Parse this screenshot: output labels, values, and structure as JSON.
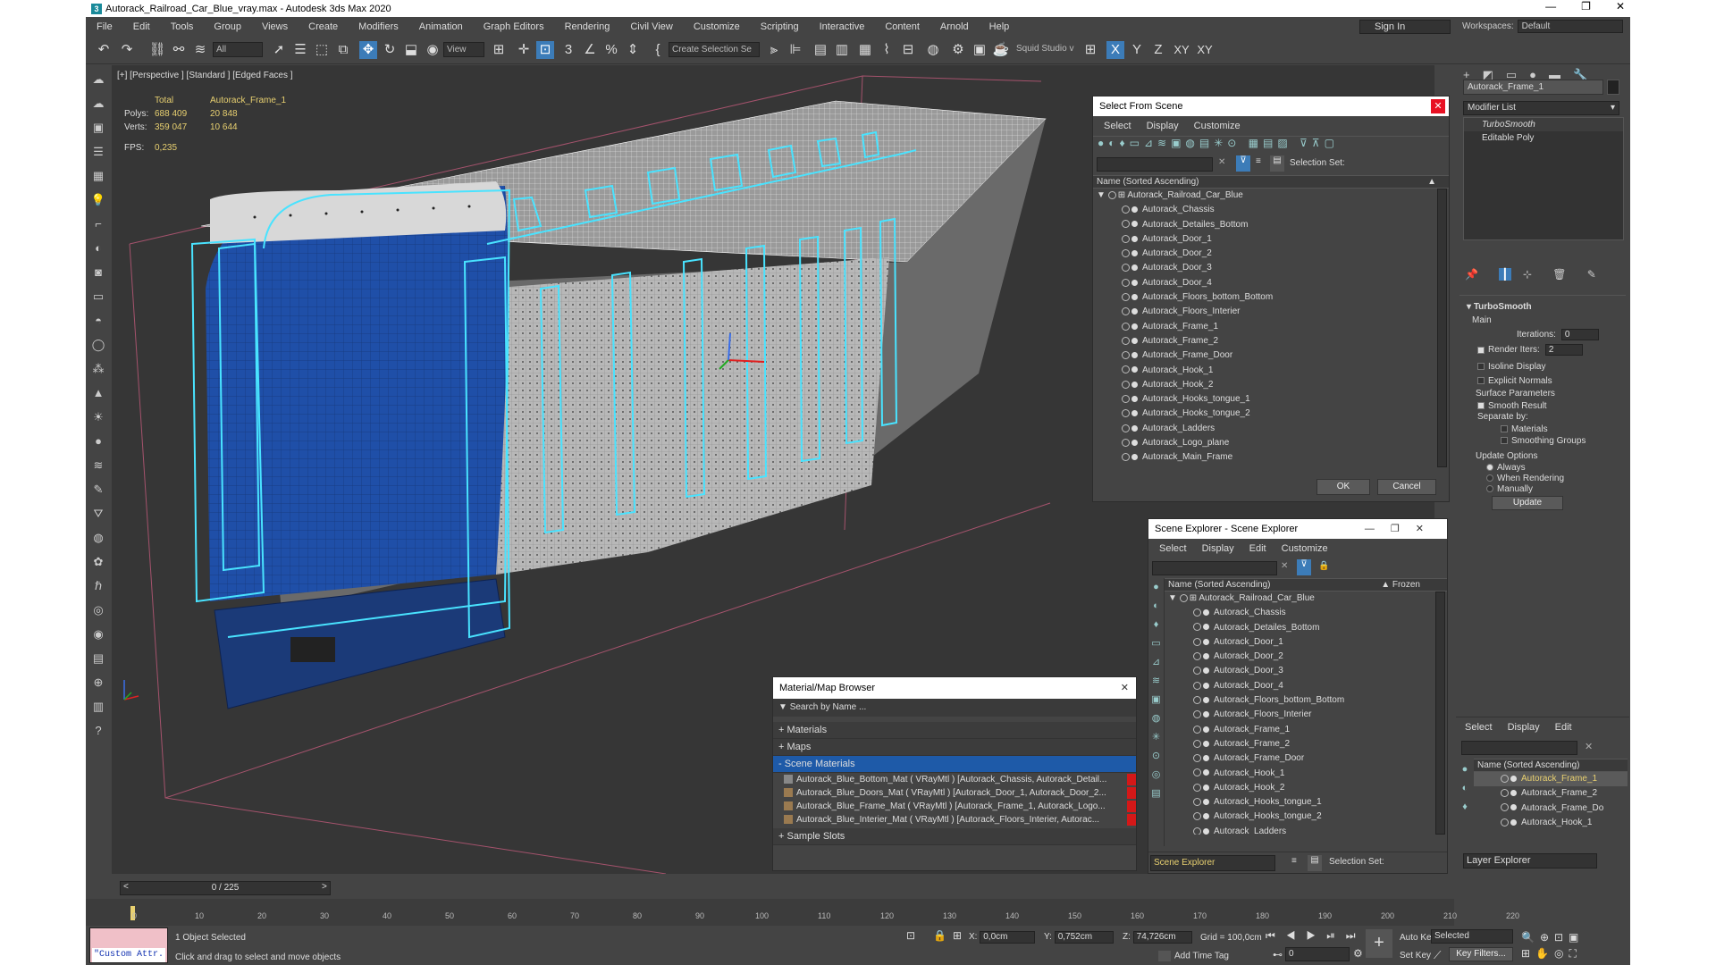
{
  "title": "Autorack_Railroad_Car_Blue_vray.max - Autodesk 3ds Max 2020",
  "menu": [
    "File",
    "Edit",
    "Tools",
    "Group",
    "Views",
    "Create",
    "Modifiers",
    "Animation",
    "Graph Editors",
    "Rendering",
    "Civil View",
    "Customize",
    "Scripting",
    "Interactive",
    "Content",
    "Arnold",
    "Help"
  ],
  "account": {
    "signin": "Sign In",
    "workspaces_label": "Workspaces:",
    "workspace": "Default"
  },
  "toolbar": {
    "filter": "All",
    "view": "View",
    "selection_set": "Create Selection Se",
    "squid": "Squid Studio v",
    "axes": [
      "X",
      "Y",
      "Z",
      "XY",
      "XY"
    ]
  },
  "viewport": {
    "label": "[+] [Perspective ] [Standard ] [Edged Faces ]",
    "stats": {
      "total_label": "Total",
      "object": "Autorack_Frame_1",
      "polys_label": "Polys:",
      "polys_total": "688 409",
      "polys_obj": "20 848",
      "verts_label": "Verts:",
      "verts_total": "359 047",
      "verts_obj": "10 644",
      "fps_label": "FPS:",
      "fps": "0,235"
    }
  },
  "select_from_scene": {
    "title": "Select From Scene",
    "menu": [
      "Select",
      "Display",
      "Customize"
    ],
    "selection_set_label": "Selection Set:",
    "header": "Name (Sorted Ascending)",
    "root": "Autorack_Railroad_Car_Blue",
    "items": [
      "Autorack_Chassis",
      "Autorack_Detailes_Bottom",
      "Autorack_Door_1",
      "Autorack_Door_2",
      "Autorack_Door_3",
      "Autorack_Door_4",
      "Autorack_Floors_bottom_Bottom",
      "Autorack_Floors_Interier",
      "Autorack_Frame_1",
      "Autorack_Frame_2",
      "Autorack_Frame_Door",
      "Autorack_Hook_1",
      "Autorack_Hook_2",
      "Autorack_Hooks_tongue_1",
      "Autorack_Hooks_tongue_2",
      "Autorack_Ladders",
      "Autorack_Logo_plane",
      "Autorack_Main_Frame"
    ],
    "ok": "OK",
    "cancel": "Cancel"
  },
  "scene_explorer": {
    "title": "Scene Explorer - Scene Explorer",
    "menu": [
      "Select",
      "Display",
      "Edit",
      "Customize"
    ],
    "header": "Name (Sorted Ascending)",
    "frozen": "▲ Frozen",
    "root": "Autorack_Railroad_Car_Blue",
    "items": [
      "Autorack_Chassis",
      "Autorack_Detailes_Bottom",
      "Autorack_Door_1",
      "Autorack_Door_2",
      "Autorack_Door_3",
      "Autorack_Door_4",
      "Autorack_Floors_bottom_Bottom",
      "Autorack_Floors_Interier",
      "Autorack_Frame_1",
      "Autorack_Frame_2",
      "Autorack_Frame_Door",
      "Autorack_Hook_1",
      "Autorack_Hook_2",
      "Autorack_Hooks_tongue_1",
      "Autorack_Hooks_tongue_2",
      "Autorack_Ladders"
    ],
    "footer": "Scene Explorer",
    "selection_set_label": "Selection Set:"
  },
  "material_browser": {
    "title": "Material/Map Browser",
    "search": "Search by Name ...",
    "groups": [
      "+ Materials",
      "+ Maps",
      "- Scene Materials",
      "+ Sample Slots"
    ],
    "materials": [
      "Autorack_Blue_Bottom_Mat ( VRayMtl ) [Autorack_Chassis, Autorack_Detail...",
      "Autorack_Blue_Doors_Mat ( VRayMtl ) [Autorack_Door_1, Autorack_Door_2...",
      "Autorack_Blue_Frame_Mat ( VRayMtl ) [Autorack_Frame_1, Autorack_Logo...",
      "Autorack_Blue_Interier_Mat ( VRayMtl ) [Autorack_Floors_Interier, Autorac..."
    ]
  },
  "command_panel": {
    "object_name": "Autorack_Frame_1",
    "modifier_list": "Modifier List",
    "stack": [
      "TurboSmooth",
      "Editable Poly"
    ],
    "turbosmooth": {
      "title": "TurboSmooth",
      "main": "Main",
      "iterations_label": "Iterations:",
      "iterations": "0",
      "render_iters_label": "Render Iters:",
      "render_iters": "2",
      "isoline": "Isoline Display",
      "explicit": "Explicit Normals",
      "surface": "Surface Parameters",
      "smooth": "Smooth Result",
      "separate": "Separate by:",
      "materials": "Materials",
      "smoothing": "Smoothing Groups",
      "update_options": "Update Options",
      "always": "Always",
      "when_rendering": "When Rendering",
      "manually": "Manually",
      "update": "Update"
    }
  },
  "layer_explorer": {
    "menu": [
      "Select",
      "Display",
      "Edit"
    ],
    "header": "Name (Sorted Ascending)",
    "items": [
      "Autorack_Frame_1",
      "Autorack_Frame_2",
      "Autorack_Frame_Do",
      "Autorack_Hook_1"
    ],
    "footer": "Layer Explorer"
  },
  "timeline": {
    "frame": "0 / 225",
    "ticks": [
      "0",
      "10",
      "20",
      "30",
      "40",
      "50",
      "60",
      "70",
      "80",
      "90",
      "100",
      "110",
      "120",
      "130",
      "140",
      "150",
      "160",
      "170",
      "180",
      "190",
      "200",
      "210",
      "220"
    ]
  },
  "status": {
    "maxscript": "\"Custom Attr.",
    "selected": "1 Object Selected",
    "prompt": "Click and drag to select and move objects",
    "x_label": "X:",
    "x": "0,0cm",
    "y_label": "Y:",
    "y": "0,752cm",
    "z_label": "Z:",
    "z": "74,726cm",
    "grid": "Grid = 100,0cm",
    "add_time_tag": "Add Time Tag",
    "auto_key": "Auto Key",
    "selected_dd": "Selected",
    "set_key": "Set Key",
    "key_filters": "Key Filters...",
    "frame": "0"
  }
}
